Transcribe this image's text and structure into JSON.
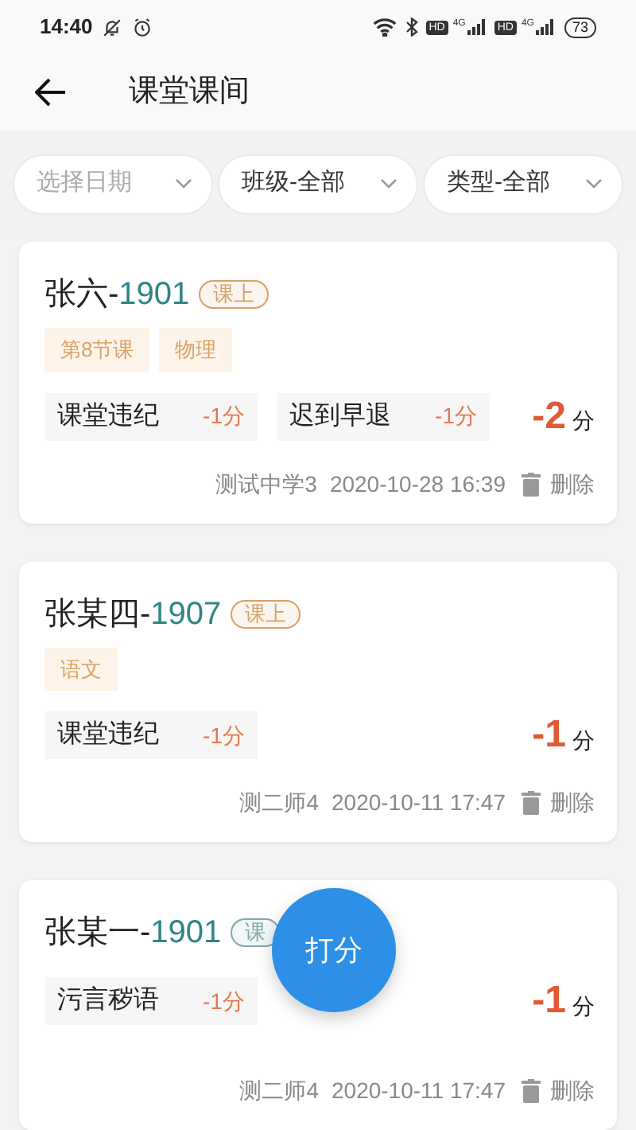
{
  "status_bar": {
    "time": "14:40",
    "network_labels": [
      "HD",
      "4G",
      "HD",
      "4G"
    ],
    "battery": "73"
  },
  "header": {
    "title": "课堂课间"
  },
  "filters": [
    {
      "label": "选择日期",
      "placeholder": true
    },
    {
      "label": "班级-全部",
      "placeholder": false
    },
    {
      "label": "类型-全部",
      "placeholder": false
    }
  ],
  "records": [
    {
      "name": "张六-",
      "class": "1901",
      "badge": {
        "label": "课上",
        "color": "#d9a066"
      },
      "tags": [
        "第8节课",
        "物理"
      ],
      "deductions": [
        {
          "label": "课堂违纪",
          "points": "-1分"
        },
        {
          "label": "迟到早退",
          "points": "-1分"
        }
      ],
      "total": "-2",
      "unit": "分",
      "author": "测试中学3",
      "time": "2020-10-28 16:39",
      "delete": "删除"
    },
    {
      "name": "张某四-",
      "class": "1907",
      "badge": {
        "label": "课上",
        "color": "#d9a066"
      },
      "tags": [
        "语文"
      ],
      "deductions": [
        {
          "label": "课堂违纪",
          "points": "-1分"
        }
      ],
      "total": "-1",
      "unit": "分",
      "author": "测二师4",
      "time": "2020-10-11 17:47",
      "delete": "删除"
    },
    {
      "name": "张某一-",
      "class": "1901",
      "badge": {
        "label": "课",
        "color": "#7fa8aa"
      },
      "deductions": [
        {
          "label": "污言秽语",
          "points": "-1分"
        }
      ],
      "total": "-1",
      "unit": "分",
      "author": "测二师4",
      "time": "2020-10-11 17:47",
      "delete": "删除"
    }
  ],
  "fab": {
    "label": "打分"
  }
}
